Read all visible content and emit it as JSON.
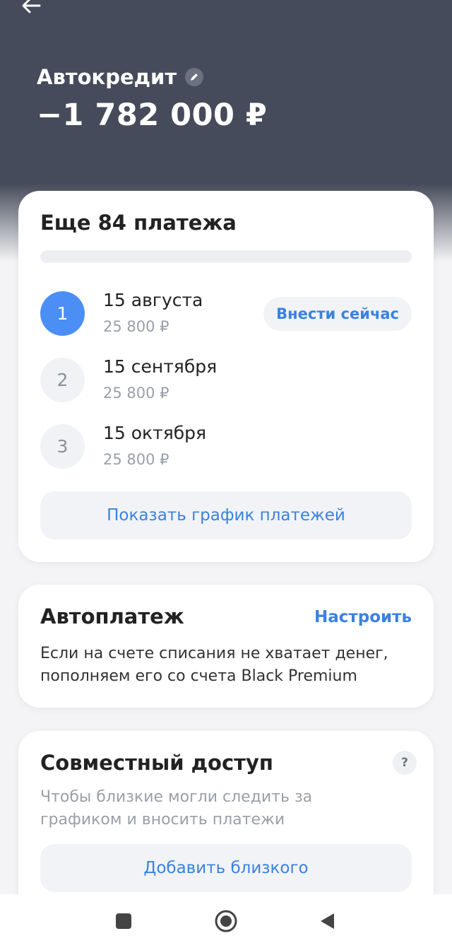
{
  "header": {
    "title": "Автокредит",
    "amount": "−1 782 000 ₽"
  },
  "payments_card": {
    "title": "Еще 84 платежа",
    "progress": 0,
    "payments": [
      {
        "num": "1",
        "date": "15 августа",
        "sum": "25 800 ₽"
      },
      {
        "num": "2",
        "date": "15 сентября",
        "sum": "25 800 ₽"
      },
      {
        "num": "3",
        "date": "15 октября",
        "sum": "25 800 ₽"
      }
    ],
    "pay_now_label": "Внести сейчас",
    "schedule_label": "Показать график платежей"
  },
  "autopay_card": {
    "title": "Автоплатеж",
    "setup_label": "Настроить",
    "description": "Если на счете списания не хватает денег, пополняем его со счета Black Premium"
  },
  "shared_card": {
    "title": "Совместный доступ",
    "help": "?",
    "description": "Чтобы близкие могли следить за графиком и вносить платежи",
    "add_label": "Добавить близкого"
  },
  "colors": {
    "header_bg": "#454b5a",
    "accent": "#3a82e0",
    "active_step": "#4b8ef5"
  },
  "icons": {
    "back": "arrow-left-icon",
    "edit": "pencil-icon",
    "nav": [
      "square-icon",
      "circle-icon",
      "triangle-back-icon"
    ]
  }
}
